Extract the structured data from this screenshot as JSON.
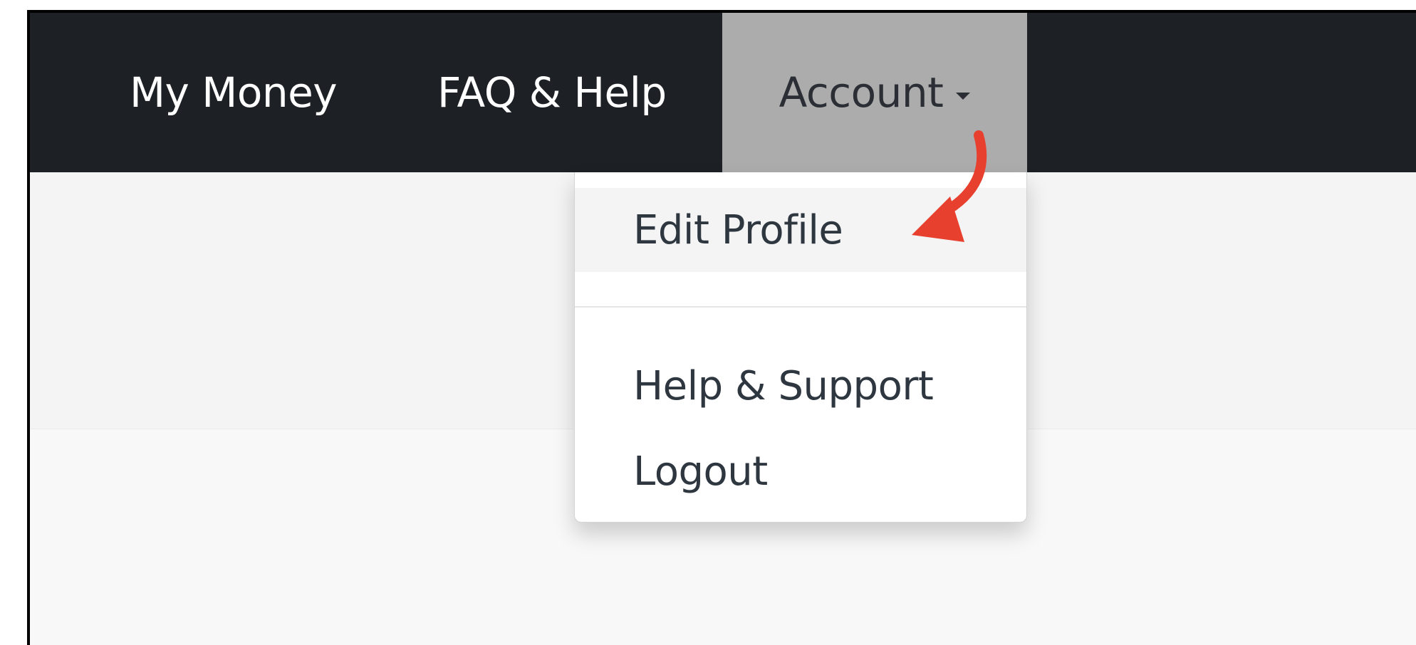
{
  "navbar": {
    "items": [
      {
        "label": "My Money"
      },
      {
        "label": "FAQ & Help"
      },
      {
        "label": "Account",
        "active": true
      }
    ]
  },
  "dropdown": {
    "items": [
      {
        "label": "Edit Profile",
        "highlighted": true
      },
      {
        "label": "Help & Support"
      },
      {
        "label": "Logout"
      }
    ]
  },
  "colors": {
    "navbar_bg": "#1d2025",
    "account_active_bg": "#acacac",
    "annotation_arrow": "#e8402f"
  },
  "icons": {
    "account_caret": "caret-down-icon",
    "annotation": "arrow-annotation-icon"
  }
}
